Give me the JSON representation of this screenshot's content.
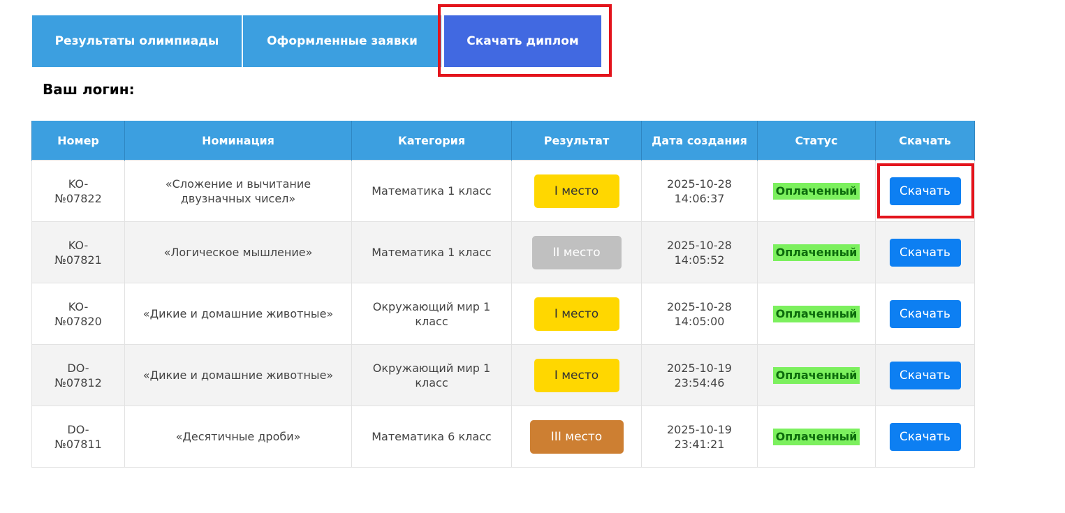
{
  "tabs": {
    "results": "Результаты олимпиады",
    "orders": "Оформленные заявки",
    "download": "Скачать диплом"
  },
  "login_label": "Ваш логин:",
  "colors": {
    "tab_bg": "#3c9fe0",
    "tab_active_bg": "#4169e1",
    "highlight": "#e3141c",
    "status_bg": "#7cf05e",
    "button_bg": "#0d7ff2"
  },
  "table": {
    "headers": {
      "number": "Номер",
      "nomination": "Номинация",
      "category": "Категория",
      "result": "Результат",
      "created": "Дата создания",
      "status": "Статус",
      "download": "Скачать"
    },
    "rows": [
      {
        "number_prefix": "KO-",
        "number": "№07822",
        "nomination": "«Сложение и вычитание двузначных чисел»",
        "category": "Математика 1 класс",
        "result": "I место",
        "date": "2025-10-28",
        "time": "14:06:37",
        "status": "Оплаченный",
        "button": "Скачать"
      },
      {
        "number_prefix": "KO-",
        "number": "№07821",
        "nomination": "«Логическое мышление»",
        "category": "Математика 1 класс",
        "result": "II место",
        "date": "2025-10-28",
        "time": "14:05:52",
        "status": "Оплаченный",
        "button": "Скачать"
      },
      {
        "number_prefix": "KO-",
        "number": "№07820",
        "nomination": "«Дикие и домашние животные»",
        "category": "Окружающий мир 1 класс",
        "result": "I место",
        "date": "2025-10-28",
        "time": "14:05:00",
        "status": "Оплаченный",
        "button": "Скачать"
      },
      {
        "number_prefix": "DO-",
        "number": "№07812",
        "nomination": "«Дикие и домашние животные»",
        "category": "Окружающий мир 1 класс",
        "result": "I место",
        "date": "2025-10-19",
        "time": "23:54:46",
        "status": "Оплаченный",
        "button": "Скачать"
      },
      {
        "number_prefix": "DO-",
        "number": "№07811",
        "nomination": "«Десятичные дроби»",
        "category": "Математика 6 класс",
        "result": "III место",
        "date": "2025-10-19",
        "time": "23:41:21",
        "status": "Оплаченный",
        "button": "Скачать"
      }
    ]
  }
}
